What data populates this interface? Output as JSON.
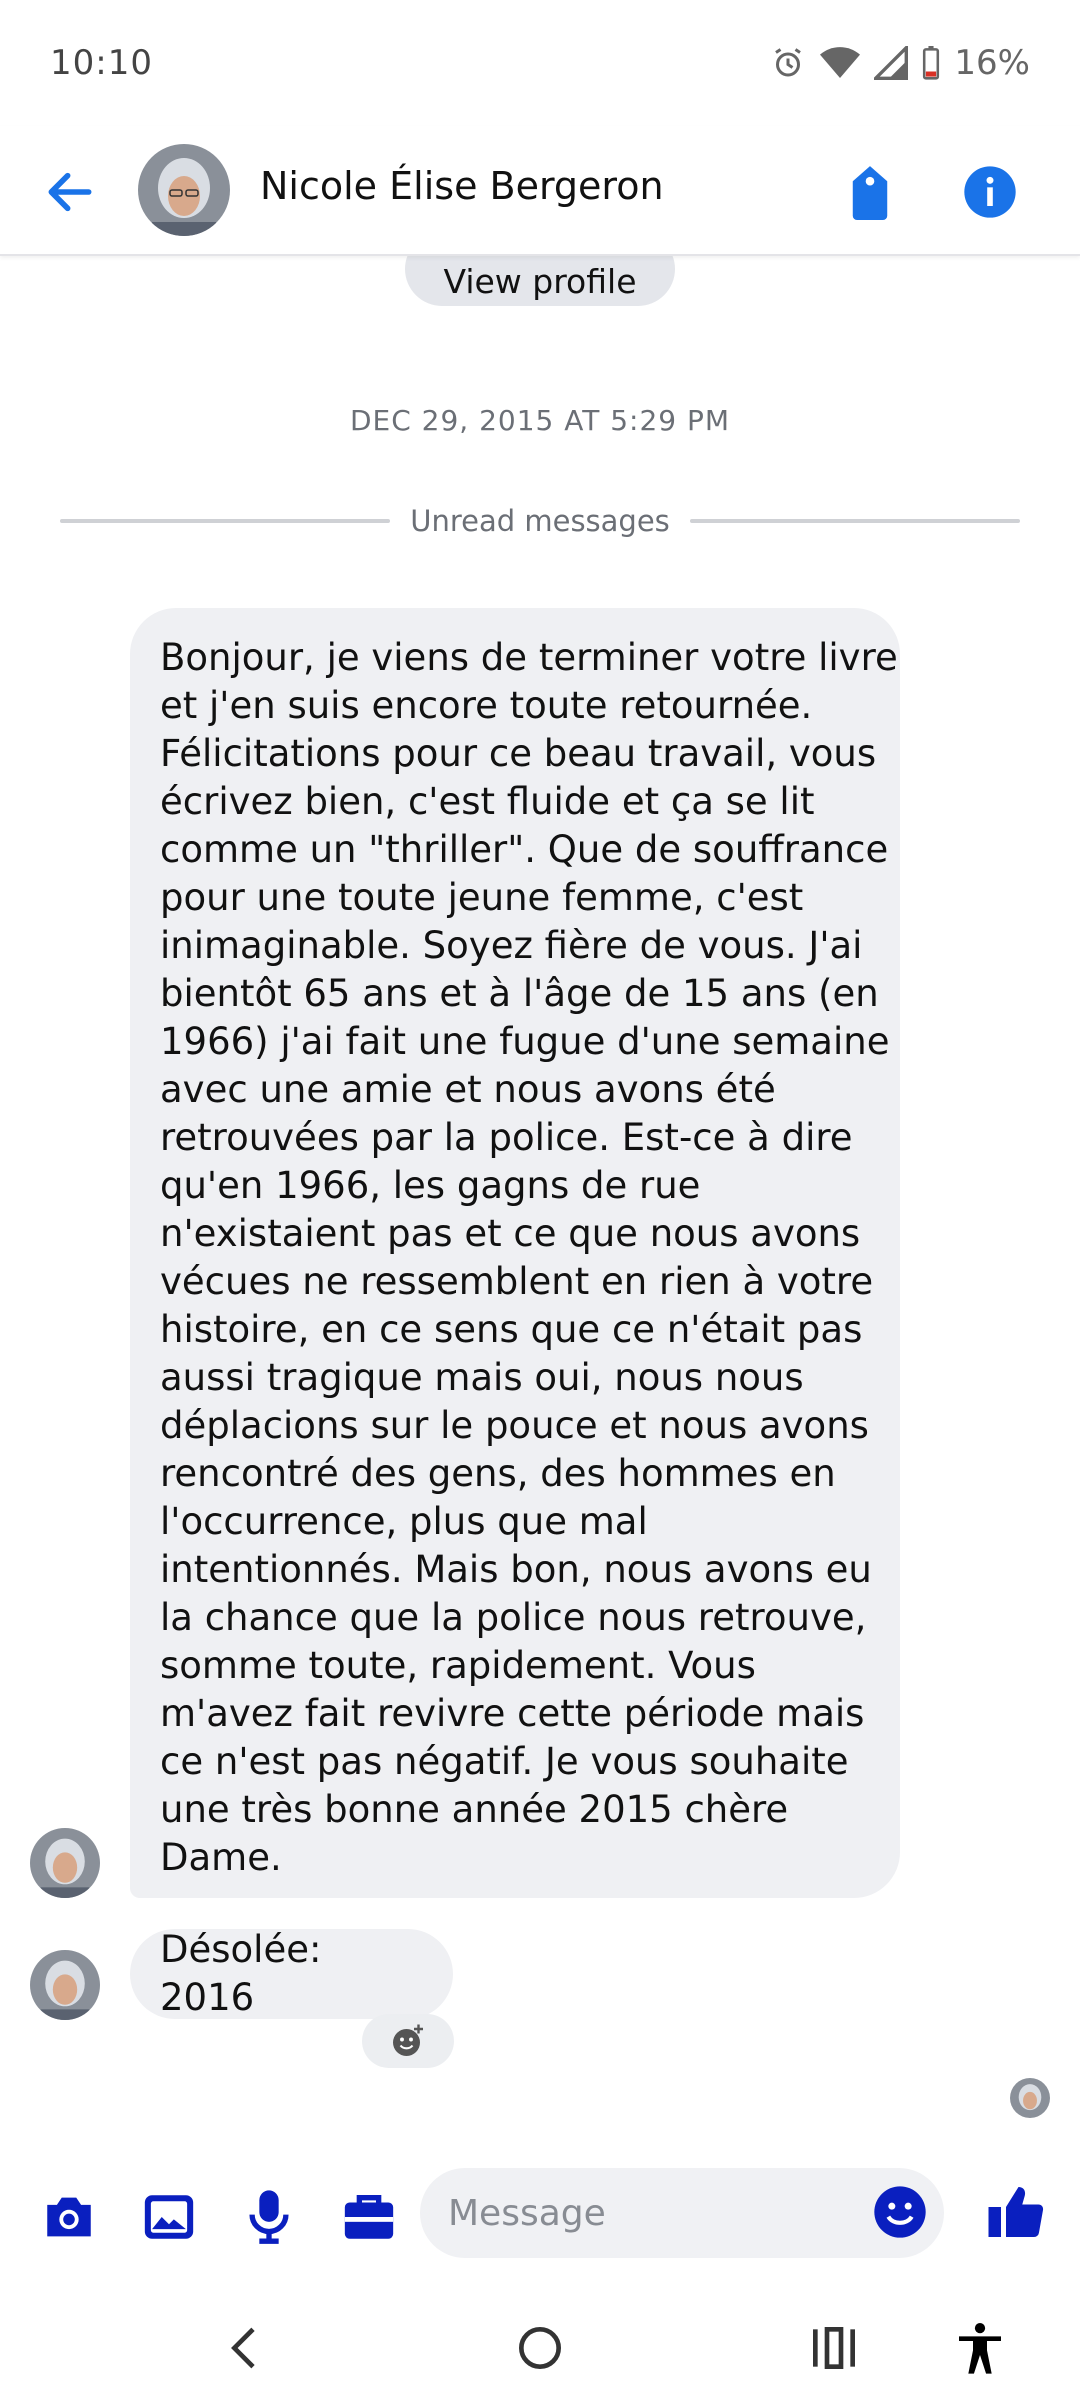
{
  "status_bar": {
    "time": "10:10",
    "battery": "16%"
  },
  "header": {
    "contact_name": "Nicole Élise Bergeron",
    "view_profile": "View profile"
  },
  "conversation": {
    "date": "DEC 29, 2015 AT 5:29 PM",
    "unread_label": "Unread messages",
    "messages": [
      {
        "lines": [
          "Bonjour, je viens de terminer votre livre",
          "et j'en suis encore toute retournée.",
          "Félicitations pour ce beau travail, vous",
          "écrivez bien, c'est fluide et ça se lit",
          "comme un \"thriller\".  Que de souffrance",
          "pour une toute jeune femme, c'est",
          "inimaginable.  Soyez fière de vous.  J'ai",
          "bientôt 65 ans et à l'âge de 15 ans (en",
          "1966) j'ai fait une fugue d'une semaine",
          "avec une amie et nous avons été",
          "retrouvées par la police.  Est-ce à dire",
          "qu'en 1966, les gagns de rue",
          "n'existaient pas et ce que nous avons",
          "vécues ne ressemblent en rien à votre",
          "histoire, en ce sens que ce n'était pas",
          "aussi tragique mais oui, nous nous",
          "déplacions sur le pouce et nous avons",
          "rencontré des gens, des hommes en",
          "l'occurrence, plus que mal",
          "intentionnés.  Mais bon, nous avons eu",
          "la chance que la police nous retrouve,",
          "somme toute, rapidement.  Vous",
          "m'avez fait revivre cette période mais",
          "ce n'est pas négatif.  Je vous souhaite",
          "une très bonne année 2015 chère",
          "Dame."
        ]
      },
      {
        "text": "Désolée: 2016"
      }
    ]
  },
  "composer": {
    "placeholder": "Message"
  },
  "colors": {
    "accent": "#1a73e8",
    "icon_blue": "#0a1fbf",
    "bubble_bg": "#eff0f3"
  }
}
